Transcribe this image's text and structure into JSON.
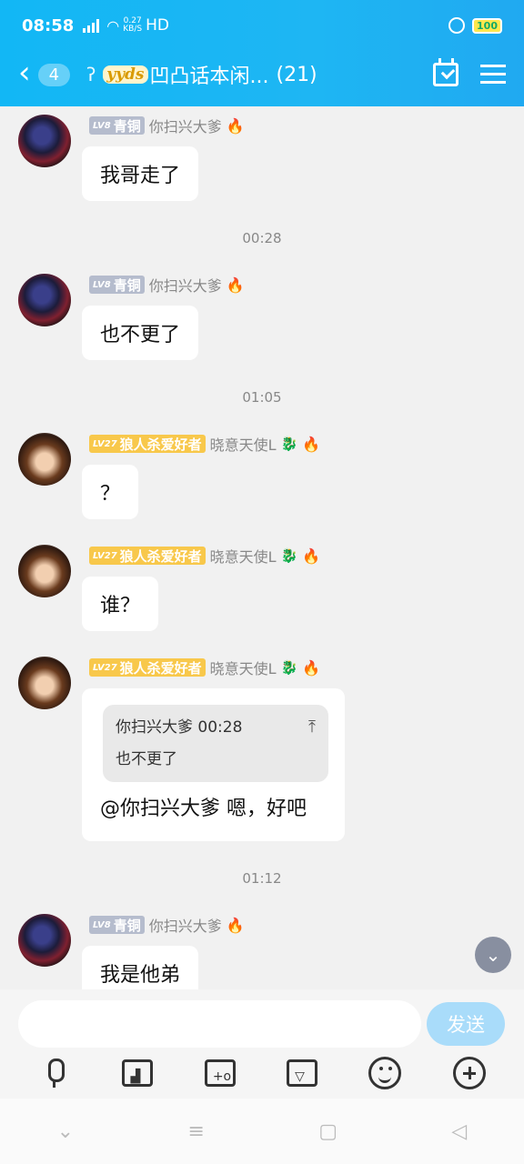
{
  "status_bar": {
    "time": "08:58",
    "signal": "4G",
    "net_speed": "0.27",
    "net_unit": "KB/S",
    "hd": "HD",
    "battery": "100"
  },
  "header": {
    "unread_count": "4",
    "logo_text": "yyds",
    "title": "凹凸话本闲...",
    "member_count": "(21)"
  },
  "messages": [
    {
      "level_prefix": "LV8",
      "level_title": "青铜",
      "sender": "你扫兴大爹",
      "text": "我哥走了"
    },
    {
      "timestamp": "00:28"
    },
    {
      "level_prefix": "LV8",
      "level_title": "青铜",
      "sender": "你扫兴大爹",
      "text": "也不更了"
    },
    {
      "timestamp": "01:05"
    },
    {
      "level_prefix": "LV27",
      "level_title": "狼人杀爱好者",
      "sender": "晓意天使L",
      "text": "？"
    },
    {
      "level_prefix": "LV27",
      "level_title": "狼人杀爱好者",
      "sender": "晓意天使L",
      "text": "谁？"
    },
    {
      "level_prefix": "LV27",
      "level_title": "狼人杀爱好者",
      "sender": "晓意天使L",
      "quote_header": "你扫兴大爹 00:28",
      "quote_text": "也不更了",
      "text": "@你扫兴大爹 嗯，好吧"
    },
    {
      "timestamp": "01:12"
    },
    {
      "level_prefix": "LV8",
      "level_title": "青铜",
      "sender": "你扫兴大爹",
      "text": "我是他弟"
    }
  ],
  "input": {
    "placeholder": "",
    "send_label": "发送"
  },
  "icons": [
    "mic-icon",
    "image-icon",
    "camera-icon",
    "file-icon",
    "emoji-icon",
    "plus-icon"
  ],
  "colors": {
    "header_blue": "#12b7f5",
    "send_button": "#a9dcfa",
    "level_silver": "#b5bccd",
    "level_gold": "#f8c84b"
  }
}
